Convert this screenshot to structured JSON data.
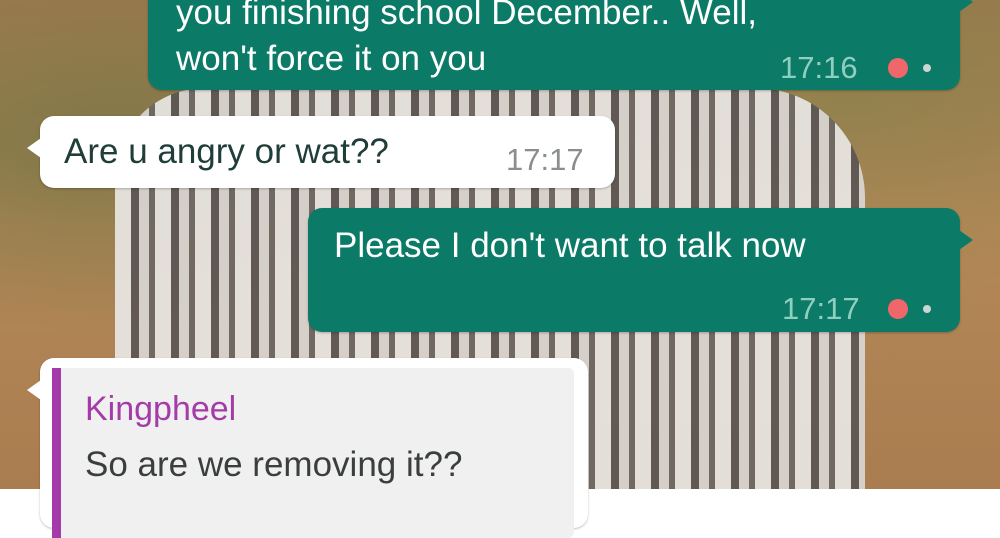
{
  "messages": [
    {
      "direction": "outgoing",
      "line1": "you finishing school December.. Well,",
      "line2": "won't force it on you",
      "time": "17:16"
    },
    {
      "direction": "incoming",
      "text": "Are u angry or wat??",
      "time": "17:17"
    },
    {
      "direction": "outgoing",
      "text": "Please I don't want to talk now",
      "time": "17:17"
    },
    {
      "direction": "incoming",
      "quoted_sender": "Kingpheel",
      "quoted_text": "So are we removing it??"
    }
  ],
  "colors": {
    "outgoing_bubble": "#0b7a66",
    "incoming_bubble": "#ffffff",
    "sender_name": "#a43ba9",
    "status_dot": "#f0676b",
    "status_small_dot": "#c9d6d2"
  }
}
